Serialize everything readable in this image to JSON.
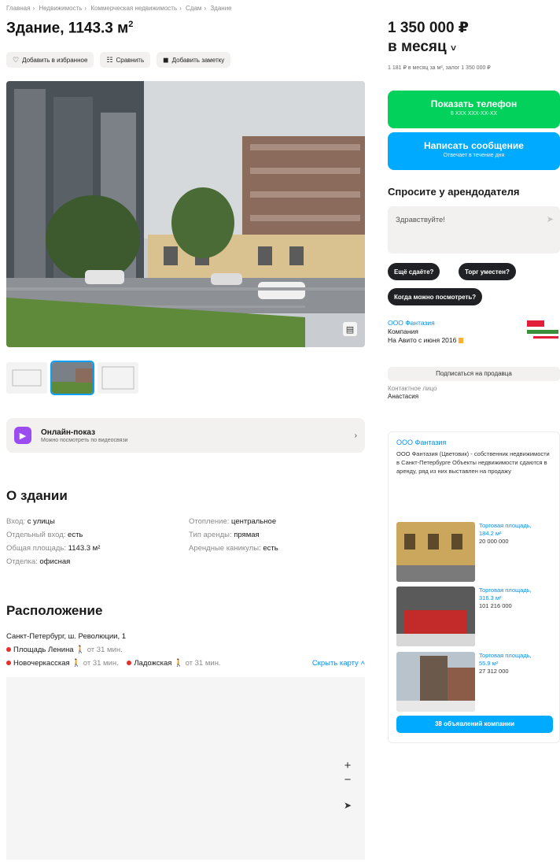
{
  "breadcrumb": [
    "Главная",
    "Недвижимость",
    "Коммерческая недвижимость",
    "Сдам",
    "Здание"
  ],
  "title": "Здание, 1143.3 м",
  "title_sup": "2",
  "actions": {
    "favorite": "Добавить в избранное",
    "compare": "Сравнить",
    "note": "Добавить заметку"
  },
  "online": {
    "title": "Онлайн-показ",
    "subtitle": "Можно посмотреть по видеосвязи"
  },
  "about": {
    "heading": "О здании",
    "left": [
      {
        "k": "Вход:",
        "v": "с улицы"
      },
      {
        "k": "Отдельный вход:",
        "v": "есть"
      },
      {
        "k": "Общая площадь:",
        "v": "1143.3 м²"
      },
      {
        "k": "Отделка:",
        "v": "офисная"
      }
    ],
    "right": [
      {
        "k": "Отопление:",
        "v": "центральное"
      },
      {
        "k": "Тип аренды:",
        "v": "прямая"
      },
      {
        "k": "Арендные каникулы:",
        "v": "есть"
      }
    ]
  },
  "location": {
    "heading": "Расположение",
    "address": "Санкт-Петербург, ш. Революции, 1",
    "metro": [
      {
        "name": "Площадь Ленина",
        "time": "от 31 мин.",
        "color": "#e4312b"
      },
      {
        "name": "Новочеркасская",
        "time": "от 31 мин.",
        "color": "#e4312b"
      },
      {
        "name": "Ладожская",
        "time": "от 31 мин.",
        "color": "#e4312b"
      }
    ],
    "hide_map": "Скрыть карту",
    "zoom_in": "+",
    "zoom_out": "−",
    "nav_icon": "location-arrow-icon"
  },
  "price": {
    "amount": "1 350 000 ₽",
    "period": "в месяц",
    "sub": "1 181 ₽ в месяц за м², залог 1 350 000 ₽"
  },
  "buttons": {
    "phone": "Показать телефон",
    "phone_sub": "8 XXX XXX-XX-XX",
    "message": "Написать сообщение",
    "message_sub": "Отвечает в течение дня"
  },
  "ask": {
    "title": "Спросите у арендодателя",
    "placeholder": "Здравствуйте!",
    "chips": [
      "Ещё сдаёте?",
      "Торг уместен?",
      "Когда можно посмотреть?"
    ]
  },
  "seller": {
    "name": "ООО Фантазия",
    "type": "Компания",
    "since": "На Авито с июня 2016",
    "subscribe": "Подписаться на продавца",
    "contact_label": "Контактное лицо",
    "contact_name": "Анастасия"
  },
  "company": {
    "name": "ООО Фантазия",
    "desc": "ООО Фантазия (Цветовик) - собственник недвижимости в Санкт-Петербурге Объекты недвижимости сдаются в аренду, ряд из них выставлен на продажу",
    "items": [
      {
        "title": "Торговая площадь,",
        "area": "184.2 м²",
        "price": "20 000 000"
      },
      {
        "title": "Торговая площадь,",
        "area": "316.3 м²",
        "price": "101 216 000"
      },
      {
        "title": "Торговая площадь,",
        "area": "55.9 м²",
        "price": "27 312 000"
      }
    ],
    "all_button": "38 объявлений компании"
  },
  "colors": {
    "green": "#02d15c",
    "blue": "#00aaff",
    "link": "#0a8fe8"
  }
}
